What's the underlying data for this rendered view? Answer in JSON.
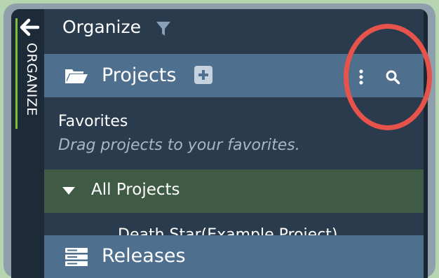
{
  "rail": {
    "back_icon": "arrow-left-icon",
    "label": "ORGANIZE",
    "accent_color": "#7cbf3a"
  },
  "header": {
    "title": "Organize",
    "filter_icon": "filter-icon"
  },
  "projects_bar": {
    "folder_icon": "folder-open-icon",
    "label": "Projects",
    "add_icon": "plus-square-icon",
    "menu_icon": "kebab-menu-icon",
    "search_icon": "search-icon"
  },
  "favorites": {
    "title": "Favorites",
    "hint": "Drag projects to your favorites."
  },
  "all_projects": {
    "caret_icon": "caret-down-icon",
    "label": "All Projects",
    "items": [
      {
        "label": "Death Star(Example Project)"
      }
    ]
  },
  "releases": {
    "icon": "server-stack-icon",
    "label": "Releases"
  },
  "colors": {
    "background": "#b7d4b1",
    "panel": "#2a3b4d",
    "rail": "#1d2a38",
    "bar": "#4e6f8e",
    "selected_row": "#3f5a45",
    "highlight_ring": "#e5534b"
  }
}
